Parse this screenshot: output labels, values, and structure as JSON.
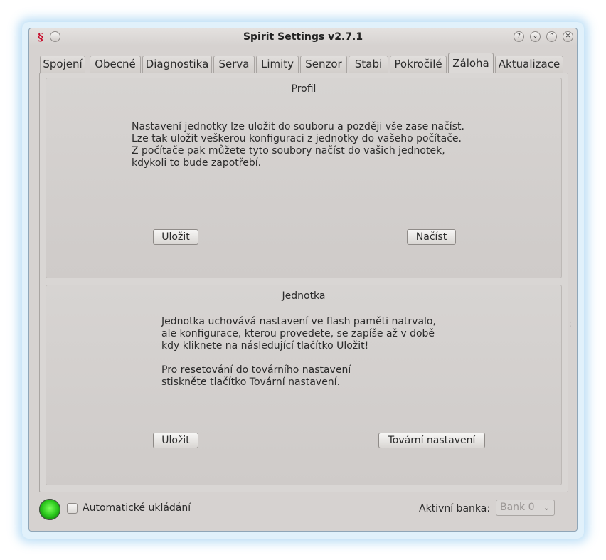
{
  "window": {
    "title": "Spirit Settings v2.7.1",
    "controls": [
      "?",
      "⌄",
      "⌃",
      "✕"
    ]
  },
  "tabs": [
    {
      "label": "Spojení",
      "active": false
    },
    {
      "label": "Obecné",
      "active": false
    },
    {
      "label": "Diagnostika",
      "active": false
    },
    {
      "label": "Serva",
      "active": false
    },
    {
      "label": "Limity",
      "active": false
    },
    {
      "label": "Senzor",
      "active": false
    },
    {
      "label": "Stabi",
      "active": false
    },
    {
      "label": "Pokročilé",
      "active": false
    },
    {
      "label": "Záloha",
      "active": true
    },
    {
      "label": "Aktualizace",
      "active": false
    }
  ],
  "profile": {
    "title": "Profil",
    "text": "Nastavení jednotky lze uložit do souboru a později vše zase načíst.\nLze tak uložit veškerou konfiguraci z jednotky do vašeho počítače.\nZ počítače pak můžete tyto soubory načíst do vašich jednotek,\nkdykoli to bude zapotřebí.",
    "save_label": "Uložit",
    "load_label": "Načíst"
  },
  "unit": {
    "title": "Jednotka",
    "text": "Jednotka uchovává nastavení ve flash paměti natrvalo,\nale konfigurace, kterou provedete, se zapíše až v době\nkdy kliknete na následující tlačítko Uložit!\n\nPro resetování do továrního nastavení\nstiskněte tlačítko Tovární nastavení.",
    "save_label": "Uložit",
    "factory_label": "Tovární nastavení"
  },
  "footer": {
    "status_color": "#2ecb1f",
    "autosave_label": "Automatické ukládání",
    "autosave_checked": false,
    "bank_label": "Aktivní banka:",
    "bank_value": "Bank 0"
  }
}
